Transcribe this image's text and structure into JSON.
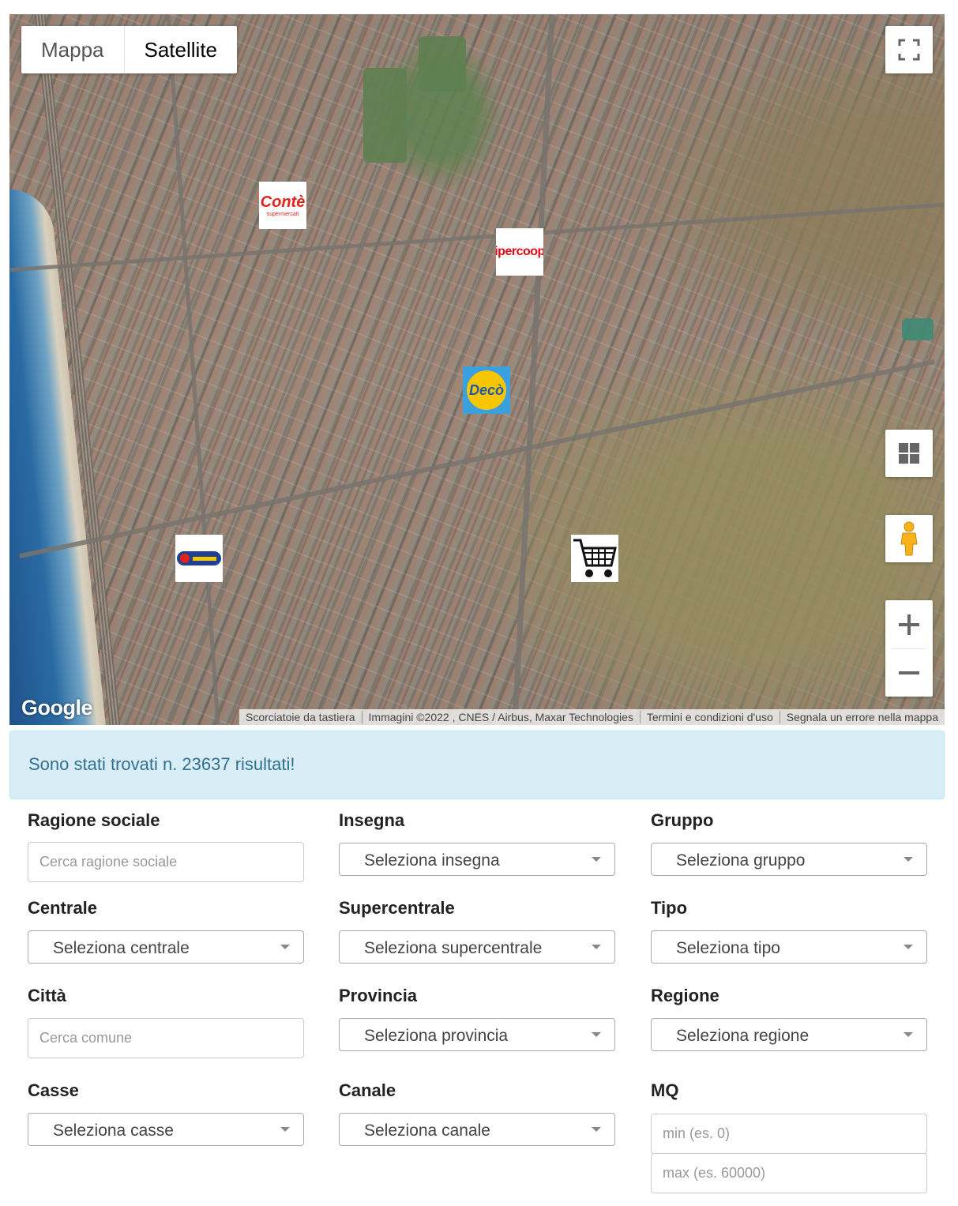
{
  "map": {
    "type_options": [
      "Mappa",
      "Satellite"
    ],
    "active_type": "Satellite",
    "markers": [
      "Conte supermercati",
      "ipercoop",
      "Decò",
      "Sigma",
      "shopping-cart"
    ],
    "google_logo": "Google",
    "attribution": [
      "Scorciatoie da tastiera",
      "Immagini ©2022 , CNES / Airbus, Maxar Technologies",
      "Termini e condizioni d'uso",
      "Segnala un errore nella mappa"
    ],
    "controls": [
      "fullscreen-icon",
      "grid-icon",
      "pegman-icon",
      "zoom-in-icon",
      "zoom-out-icon"
    ]
  },
  "alert": {
    "text": "Sono stati trovati n. 23637 risultati!"
  },
  "form": {
    "ragione_sociale": {
      "label": "Ragione sociale",
      "placeholder": "Cerca ragione sociale"
    },
    "insegna": {
      "label": "Insegna",
      "value": "Seleziona insegna"
    },
    "gruppo": {
      "label": "Gruppo",
      "value": "Seleziona gruppo"
    },
    "centrale": {
      "label": "Centrale",
      "value": "Seleziona centrale"
    },
    "supercentrale": {
      "label": "Supercentrale",
      "value": "Seleziona supercentrale"
    },
    "tipo": {
      "label": "Tipo",
      "value": "Seleziona tipo"
    },
    "citta": {
      "label": "Città",
      "placeholder": "Cerca comune"
    },
    "provincia": {
      "label": "Provincia",
      "value": "Seleziona provincia"
    },
    "regione": {
      "label": "Regione",
      "value": "Seleziona regione"
    },
    "casse": {
      "label": "Casse",
      "value": "Seleziona casse"
    },
    "canale": {
      "label": "Canale",
      "value": "Seleziona canale"
    },
    "mq": {
      "label": "MQ",
      "min_placeholder": "min (es. 0)",
      "max_placeholder": "max (es. 60000)"
    }
  },
  "colors": {
    "alert_bg": "#d9edf7",
    "alert_text": "#31708f",
    "conte_red": "#e2231a",
    "ipercoop_red": "#e30613",
    "deco_blue": "#1e5aa8",
    "deco_yellow": "#f7c600"
  }
}
